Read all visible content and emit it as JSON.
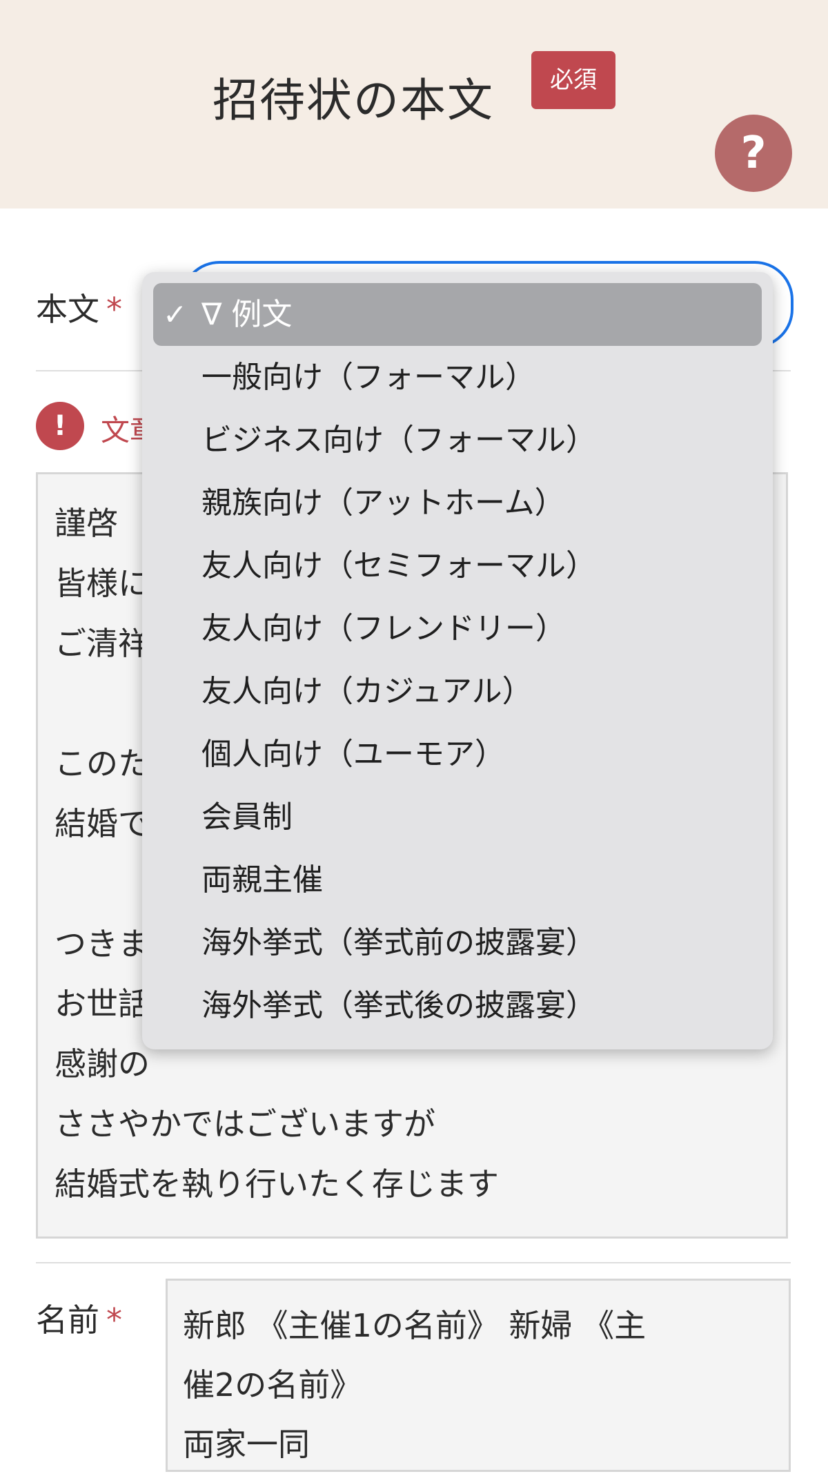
{
  "header": {
    "title": "招待状の本文",
    "required_badge": "必須",
    "help_label": "?"
  },
  "body_field": {
    "label": "本文",
    "required_mark": "*",
    "error_text": "文章",
    "error_icon_label": "!",
    "textarea_lines": [
      "謹啓",
      "皆様に",
      "ご清祥",
      "",
      "このた",
      "結婚で",
      "",
      "つきま",
      "お世話",
      "感謝の",
      "ささやかではございますが",
      "結婚式を執り行いたく存じます"
    ]
  },
  "dropdown": {
    "check_mark": "✓",
    "options": [
      "∇ 例文",
      "一般向け（フォーマル）",
      "ビジネス向け（フォーマル）",
      "親族向け（アットホーム）",
      "友人向け（セミフォーマル）",
      "友人向け（フレンドリー）",
      "友人向け（カジュアル）",
      "個人向け（ユーモア）",
      "会員制",
      "両親主催",
      "海外挙式（挙式前の披露宴）",
      "海外挙式（挙式後の披露宴）"
    ],
    "selected_index": 0
  },
  "name_field": {
    "label": "名前",
    "required_mark": "*",
    "lines": [
      "新郎 《主催1の名前》 新婦 《主",
      "催2の名前》",
      "両家一同"
    ]
  },
  "colors": {
    "header_bg": "#f5ede5",
    "accent_red": "#c0484f",
    "help_button": "#b56a6a",
    "focus_blue": "#1a73e8",
    "dropdown_bg": "#e3e3e5",
    "selected_bg": "#a6a7aa"
  }
}
